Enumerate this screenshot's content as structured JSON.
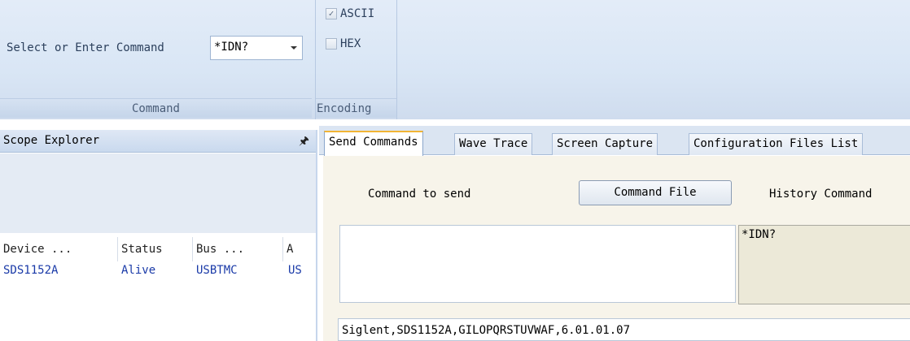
{
  "ribbon": {
    "command_group": {
      "label": "Select or Enter Command",
      "value": "*IDN?",
      "group_label": "Command"
    },
    "encoding_group": {
      "options": [
        {
          "label": "ASCII",
          "checked": true
        },
        {
          "label": "HEX",
          "checked": false
        }
      ],
      "group_label": "Encoding"
    }
  },
  "scope_explorer": {
    "title": "Scope Explorer",
    "columns": [
      "Device ...",
      "Status",
      "Bus ...",
      "A"
    ],
    "rows": [
      {
        "device": "SDS1152A",
        "status": "Alive",
        "bus": "USBTMC",
        "a": "US"
      }
    ]
  },
  "tabs": [
    {
      "label": "Send Commands",
      "active": true
    },
    {
      "label": "Wave Trace",
      "active": false
    },
    {
      "label": "Screen Capture",
      "active": false
    },
    {
      "label": "Configuration Files List",
      "active": false
    }
  ],
  "send_commands": {
    "command_to_send_label": "Command to send",
    "command_file_button": "Command File",
    "history_label": "History Command",
    "command_input": "",
    "history_items": [
      "*IDN?"
    ],
    "response": "Siglent,SDS1152A,GILOPQRSTUVWAF,6.01.01.07"
  }
}
